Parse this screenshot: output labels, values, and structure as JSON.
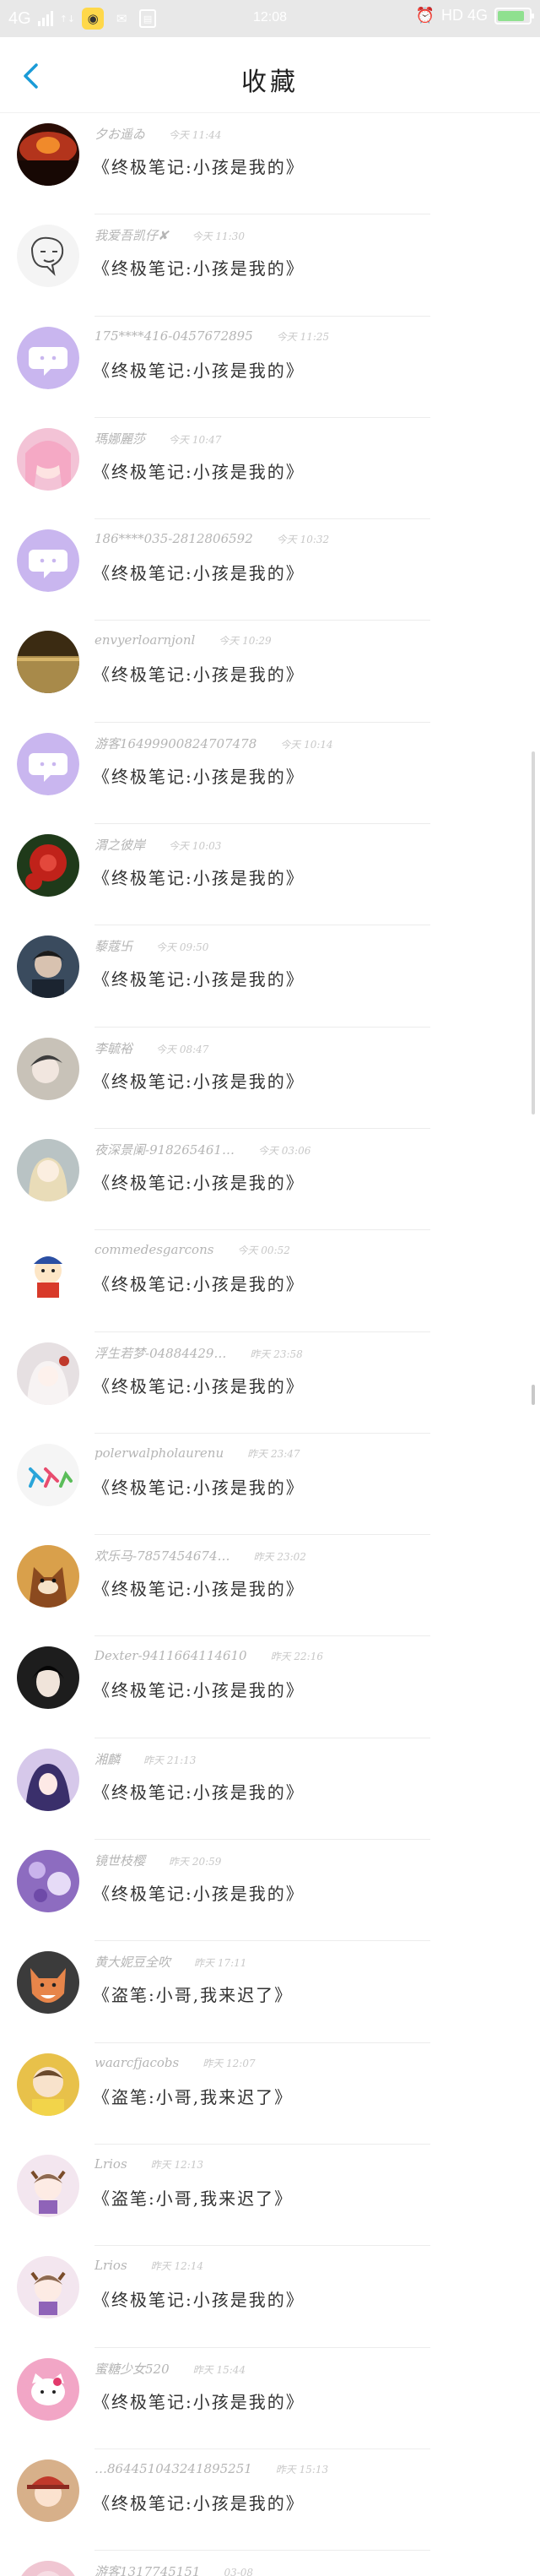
{
  "status_bar": {
    "network": "4G",
    "time": "12:08",
    "right_text": "HD 4G",
    "battery_level": 0.85
  },
  "header": {
    "title": "收藏"
  },
  "favorites": [
    {
      "name": "夕お遥ゐ",
      "time": "今天 11:44",
      "message": "《终极笔记:小孩是我的》",
      "avatar": {
        "kind": "sunset",
        "bg": "#b3341c"
      }
    },
    {
      "name": "我爱吾凯仔✘",
      "time": "今天 11:30",
      "message": "《终极笔记:小孩是我的》",
      "avatar": {
        "kind": "sketch",
        "bg": "#f4f4f4"
      }
    },
    {
      "name": "175****416-0457672895",
      "time": "今天 11:25",
      "message": "《终极笔记:小孩是我的》",
      "avatar": {
        "kind": "default",
        "bg": "#c9b6ef"
      }
    },
    {
      "name": "瑪娜麗莎",
      "time": "今天 10:47",
      "message": "《终极笔记:小孩是我的》",
      "avatar": {
        "kind": "anime-pink",
        "bg": "#f3c3d6"
      }
    },
    {
      "name": "186****035-2812806592",
      "time": "今天 10:32",
      "message": "《终极笔记:小孩是我的》",
      "avatar": {
        "kind": "default",
        "bg": "#c9b6ef"
      }
    },
    {
      "name": "envyerloarnjonl",
      "time": "今天 10:29",
      "message": "《终极笔记:小孩是我的》",
      "avatar": {
        "kind": "sea",
        "bg": "#a88a4a"
      }
    },
    {
      "name": "游客16499900824707478",
      "time": "今天 10:14",
      "message": "《终极笔记:小孩是我的》",
      "avatar": {
        "kind": "default",
        "bg": "#c9b6ef"
      }
    },
    {
      "name": "渭之彼岸",
      "time": "今天 10:03",
      "message": "《终极笔记:小孩是我的》",
      "avatar": {
        "kind": "flower",
        "bg": "#c0221a"
      }
    },
    {
      "name": "藜蔻卐",
      "time": "今天 09:50",
      "message": "《终极笔记:小孩是我的》",
      "avatar": {
        "kind": "boy-dark",
        "bg": "#3a4b5e"
      }
    },
    {
      "name": "李毓裕",
      "time": "今天 08:47",
      "message": "《终极笔记:小孩是我的》",
      "avatar": {
        "kind": "boy-light",
        "bg": "#c8c2b8"
      }
    },
    {
      "name": "夜深景阑-918265461…",
      "time": "今天 03:06",
      "message": "《终极笔记:小孩是我的》",
      "avatar": {
        "kind": "girl-blonde",
        "bg": "#b9c3c4"
      }
    },
    {
      "name": "commedesgarcons",
      "time": "今天 00:52",
      "message": "《终极笔记:小孩是我的》",
      "avatar": {
        "kind": "cartoon",
        "bg": "#ffffff"
      }
    },
    {
      "name": "浮生若梦-04884429…",
      "time": "昨天 23:58",
      "message": "《终极笔记:小孩是我的》",
      "avatar": {
        "kind": "girl-white",
        "bg": "#e6e0e2"
      }
    },
    {
      "name": "polerwalpholaurenu",
      "time": "昨天 23:47",
      "message": "《终极笔记:小孩是我的》",
      "avatar": {
        "kind": "runners",
        "bg": "#f5f5f5"
      }
    },
    {
      "name": "欢乐马-7857454674…",
      "time": "昨天 23:02",
      "message": "《终极笔记:小孩是我的》",
      "avatar": {
        "kind": "cat",
        "bg": "#d9a04b"
      }
    },
    {
      "name": "Dexter-9411664114610",
      "time": "昨天 22:16",
      "message": "《终极笔记:小孩是我的》",
      "avatar": {
        "kind": "dark-face",
        "bg": "#1d1d1d"
      }
    },
    {
      "name": "湘麟",
      "time": "昨天 21:13",
      "message": "《终极笔记:小孩是我的》",
      "avatar": {
        "kind": "anime-purple",
        "bg": "#d6c8ea"
      }
    },
    {
      "name": "镜世枝樱",
      "time": "昨天 20:59",
      "message": "《终极笔记:小孩是我的》",
      "avatar": {
        "kind": "purple-flowers",
        "bg": "#8d6cc0"
      }
    },
    {
      "name": "黄大妮豆全吹",
      "time": "昨天 17:11",
      "message": "《盗笔:小哥,我来迟了》",
      "avatar": {
        "kind": "fox",
        "bg": "#e7854a"
      }
    },
    {
      "name": "waarcfjacobs",
      "time": "昨天 12:07",
      "message": "《盗笔:小哥,我来迟了》",
      "avatar": {
        "kind": "baby",
        "bg": "#e8c14a"
      }
    },
    {
      "name": "Lrios",
      "time": "昨天 12:13",
      "message": "《盗笔:小哥,我来迟了》",
      "avatar": {
        "kind": "chibi",
        "bg": "#f3e6ef"
      }
    },
    {
      "name": "Lrios",
      "time": "昨天 12:14",
      "message": "《终极笔记:小孩是我的》",
      "avatar": {
        "kind": "chibi",
        "bg": "#f3e6ef"
      }
    },
    {
      "name": "蜜糖少女520",
      "time": "昨天 15:44",
      "message": "《终极笔记:小孩是我的》",
      "avatar": {
        "kind": "kitty",
        "bg": "#f2a6c6"
      }
    },
    {
      "name": "…864451043241895251",
      "time": "昨天 15:13",
      "message": "《终极笔记:小孩是我的》",
      "avatar": {
        "kind": "boy-cap",
        "bg": "#d7b08a"
      }
    },
    {
      "name": "游客1317745151",
      "time": "03-08",
      "message": "",
      "avatar": {
        "kind": "pink-blur",
        "bg": "#f0c6d2"
      }
    }
  ]
}
